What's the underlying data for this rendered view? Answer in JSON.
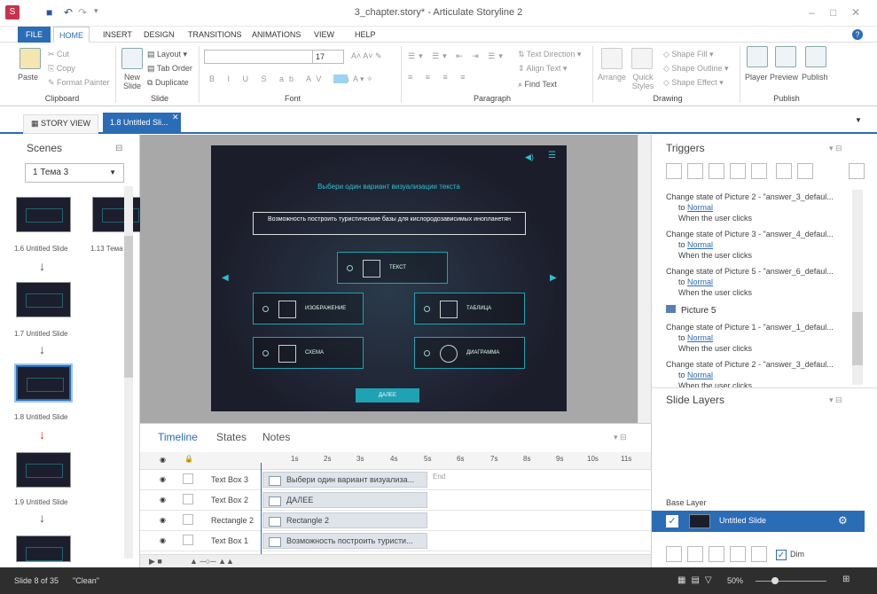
{
  "window": {
    "title": "3_chapter.story* - Articulate Storyline 2"
  },
  "ribbon_tabs": [
    "FILE",
    "HOME",
    "INSERT",
    "DESIGN",
    "TRANSITIONS",
    "ANIMATIONS",
    "VIEW",
    "HELP"
  ],
  "ribbon": {
    "clipboard": {
      "paste": "Paste",
      "cut": "Cut",
      "copy": "Copy",
      "format_painter": "Format Painter",
      "label": "Clipboard"
    },
    "slide": {
      "new_slide": "New Slide",
      "layout": "Layout",
      "tab_order": "Tab Order",
      "duplicate": "Duplicate",
      "label": "Slide"
    },
    "font": {
      "size": "17",
      "label": "Font"
    },
    "paragraph": {
      "text_direction": "Text Direction",
      "align_text": "Align Text",
      "find_text": "Find Text",
      "label": "Paragraph"
    },
    "drawing": {
      "arrange": "Arrange",
      "quick_styles": "Quick Styles",
      "shape_fill": "Shape Fill",
      "shape_outline": "Shape Outline",
      "shape_effect": "Shape Effect",
      "label": "Drawing"
    },
    "publish": {
      "player": "Player",
      "preview": "Preview",
      "publish": "Publish",
      "label": "Publish"
    }
  },
  "doc_tabs": {
    "story_view": "STORY VIEW",
    "slide": "1.8 Untitled Sli..."
  },
  "scenes": {
    "title": "Scenes",
    "dropdown": "1 Тема 3",
    "slides": [
      "1.6 Untitled Slide",
      "1.13 Тема",
      "1.7 Untitled Slide",
      "1.8 Untitled Slide",
      "1.9 Untitled Slide"
    ]
  },
  "slide": {
    "title": "Выбери один вариант визуализации текста",
    "question": "Возможность построить туристические базы для кислородозависимых инопланетян",
    "answers": [
      "ТЕКСТ",
      "ИЗОБРАЖЕНИЕ",
      "ТАБЛИЦА",
      "СХЕМА",
      "ДИАГРАММА"
    ],
    "next_button": "ДАЛЕЕ"
  },
  "timeline": {
    "tabs": [
      "Timeline",
      "States",
      "Notes"
    ],
    "ticks": [
      "1s",
      "2s",
      "3s",
      "4s",
      "5s",
      "6s",
      "7s",
      "8s",
      "9s",
      "10s",
      "11s"
    ],
    "end_label": "End",
    "rows": [
      {
        "name": "Text Box 3",
        "bar": "Выбери один вариант визуализа..."
      },
      {
        "name": "Text Box 2",
        "bar": "ДАЛЕЕ"
      },
      {
        "name": "Rectangle 2",
        "bar": "Rectangle 2"
      },
      {
        "name": "Text Box 1",
        "bar": "Возможность построить туристи..."
      }
    ]
  },
  "triggers": {
    "title": "Triggers",
    "items": [
      {
        "line1": "Change state of Picture 2 - \"answer_3_defaul...",
        "to": "to ",
        "state": "Normal",
        "when": "When the user clicks"
      },
      {
        "line1": "Change state of Picture 3 - \"answer_4_defaul...",
        "to": "to ",
        "state": "Normal",
        "when": "When the user clicks"
      },
      {
        "line1": "Change state of Picture 5 - \"answer_6_defaul...",
        "to": "to ",
        "state": "Normal",
        "when": "When the user clicks"
      },
      {
        "line1": "Change state of Picture 1 - \"answer_1_defaul...",
        "to": "to ",
        "state": "Normal",
        "when": "When the user clicks"
      },
      {
        "line1": "Change state of Picture 2 - \"answer_3_defaul...",
        "to": "to ",
        "state": "Normal",
        "when": "When the user clicks"
      }
    ],
    "group_label": "Picture 5"
  },
  "layers": {
    "title": "Slide Layers",
    "base_label": "Base Layer",
    "base_name": "Untitled Slide",
    "dim": "Dim"
  },
  "status": {
    "slide": "Slide 8 of 35",
    "theme": "\"Clean\"",
    "zoom": "50%"
  },
  "colors": {
    "accent": "#2b6cb6",
    "slide_bg": "#1c1d2b",
    "slide_accent": "#1fa2b3"
  }
}
